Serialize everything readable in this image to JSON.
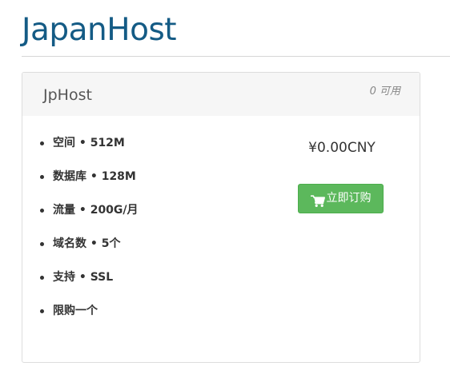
{
  "header": {
    "title": "JapanHost"
  },
  "product": {
    "name": "JpHost",
    "availability": "0 可用",
    "features": [
      {
        "name": "空间",
        "sep": " • ",
        "value": "512M"
      },
      {
        "name": "数据库",
        "sep": " • ",
        "value": "128M"
      },
      {
        "name": "流量",
        "sep": " • ",
        "value": "200G/月"
      },
      {
        "name": "域名数",
        "sep": " • ",
        "value": "5个"
      },
      {
        "name": "支持",
        "sep": " • ",
        "value": "SSL"
      },
      {
        "name": "限购一个",
        "sep": "",
        "value": ""
      }
    ],
    "price": "¥0.00CNY",
    "order_button": {
      "label": "立即订购",
      "icon": "shopping-cart-icon",
      "color": "#5cb85c"
    }
  },
  "colors": {
    "title": "#145b85",
    "header_bg": "#f6f6f6"
  }
}
